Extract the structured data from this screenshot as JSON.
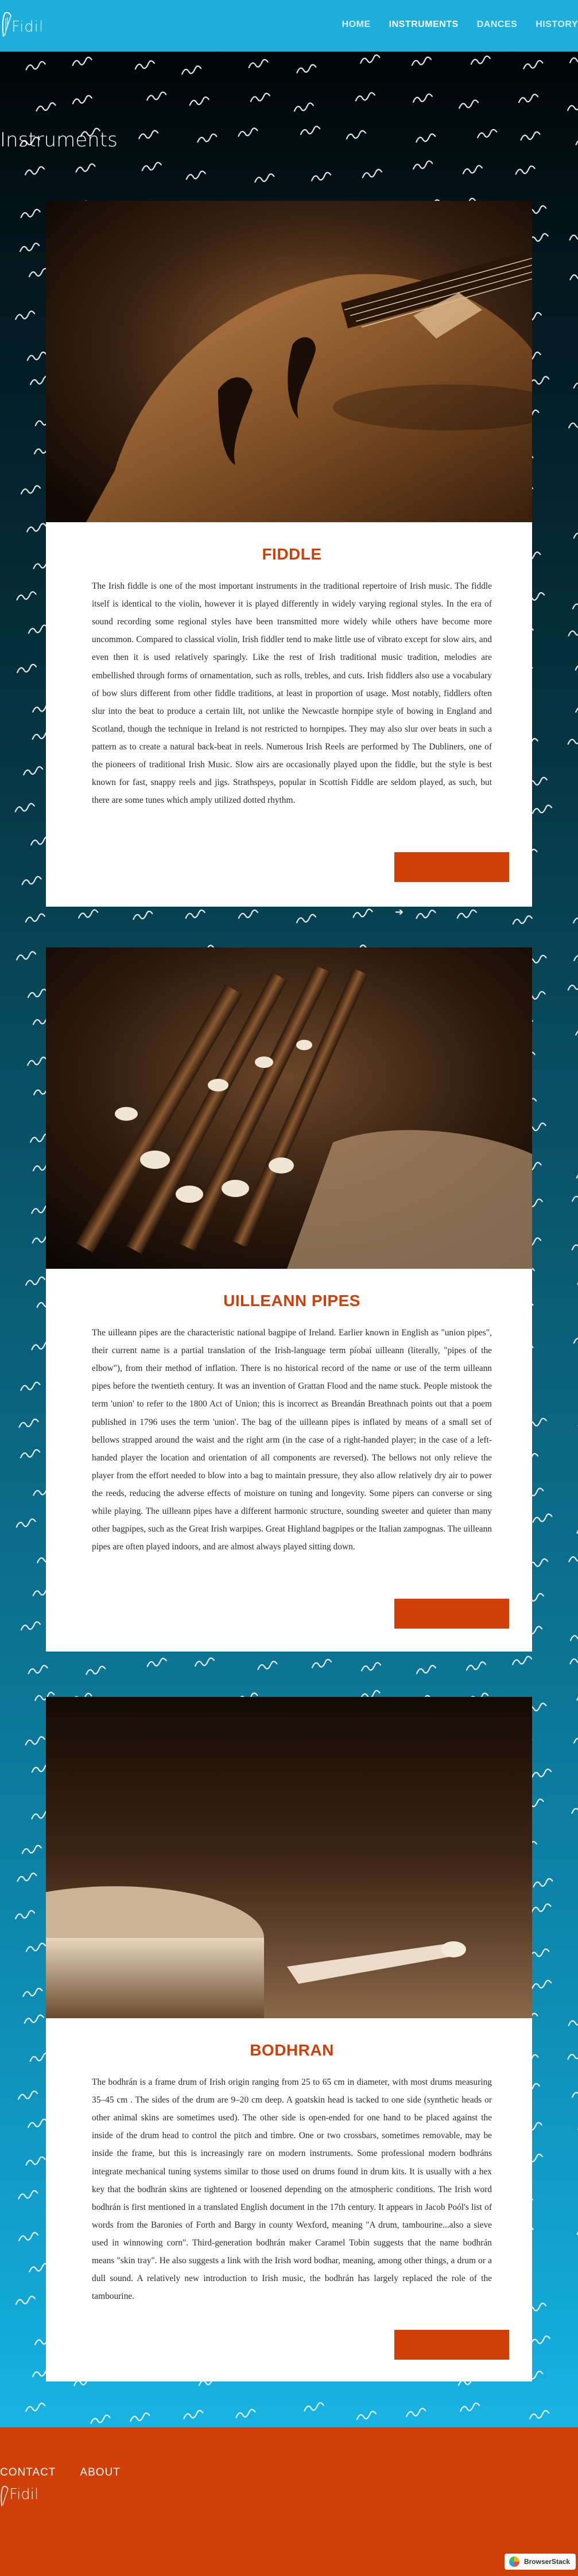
{
  "header": {
    "brand": "Fidil",
    "nav": [
      {
        "label": "HOME"
      },
      {
        "label": "INSTRUMENTS"
      },
      {
        "label": "DANCES"
      },
      {
        "label": "HISTORY"
      }
    ],
    "active_nav": "INSTRUMENTS"
  },
  "page": {
    "title": "Instruments"
  },
  "instruments": [
    {
      "name": "FIDDLE",
      "photo": "violin-photo",
      "text": "The Irish fiddle is one of the most important instruments in the traditional repertoire of Irish music. The fiddle itself is identical to the violin, however it is played differently in widely varying regional styles. In the era of sound recording some regional styles have been transmitted more widely while others have become more uncommon. Compared to classical violin, Irish fiddler tend to make little use of vibrato except for slow airs, and even then it is used relatively sparingly. Like the rest of Irish traditional music tradition, melodies are embellished through forms of ornamentation, such as rolls, trebles, and cuts. Irish fiddlers also use a vocabulary of bow slurs different from other fiddle traditions, at least in proportion of usage. Most notably, fiddlers often slur into the beat to produce a certain lilt, not unlike the Newcastle hornpipe style of bowing in England and Scotland, though the technique in Ireland is not restricted to hornpipes. They may also slur over beats in such a pattern as to create a natural back-beat in reels. Numerous Irish Reels are performed by The Dubliners, one of the pioneers of traditional Irish Music. Slow airs are occasionally played upon the fiddle, but the style is best known for fast, snappy reels and jigs. Strathspeys, popular in Scottish Fiddle are seldom played, as such, but there are some tunes which amply utilized dotted rhythm."
    },
    {
      "name": "UILLEANN PIPES",
      "photo": "pipes-photo",
      "text": "The uilleann pipes are the characteristic national bagpipe of Ireland. Earlier known in English as \"union pipes\", their current name is a partial translation of the Irish-language term píobaí uilleann (literally, \"pipes of the elbow\"), from their method of inflation. There is no historical record of the name or use of the term uilleann pipes before the twentieth century. It was an invention of Grattan Flood and the name stuck. People mistook the term 'union' to refer to the 1800 Act of Union; this is incorrect as Breandán Breathnach points out that a poem published in 1796 uses the term 'union'. The bag of the uilleann pipes is inflated by means of a small set of bellows strapped around the waist and the right arm (in the case of a right-handed player; in the case of a left-handed player the location and orientation of all components are reversed). The bellows not only relieve the player from the effort needed to blow into a bag to maintain pressure, they also allow relatively dry air to power the reeds, reducing the adverse effects of moisture on tuning and longevity. Some pipers can converse or sing while playing. The uilleann pipes have a different harmonic structure, sounding sweeter and quieter than many other bagpipes, such as the Great Irish warpipes. Great Highland bagpipes or the Italian zampognas. The uilleann pipes are often played indoors, and are almost always played sitting down."
    },
    {
      "name": "BODHRAN",
      "photo": "drum-photo",
      "text": "The bodhrán is a frame drum of Irish origin ranging from 25 to 65 cm in diameter, with most drums measuring 35–45 cm . The sides of the drum are 9–20 cm deep. A goatskin head is tacked to one side (synthetic heads or other animal skins are sometimes used). The other side is open-ended for one hand to be placed against the inside of the drum head to control the pitch and timbre. One or two crossbars, sometimes removable, may be inside the frame, but this is increasingly rare on modern instruments. Some professional modern bodhráns integrate mechanical tuning systems similar to those used on drums found in drum kits. It is usually with a hex key that the bodhrán skins are tightened or loosened depending on the atmospheric conditions. The Irish word bodhrán is first mentioned in a translated English document in the 17th century. It appears in Jacob Poól's list of words from the Baronies of Forth and Bargy in county Wexford, meaning \"A drum, tambourine...also a sieve used in winnowing corn\". Third-generation bodhrán maker Caramel Tobin suggests that the name bodhrán means \"skin tray\". He also suggests a link with the Irish word bodhar, meaning, among other things, a drum or a dull sound. A relatively new introduction to Irish music, the bodhrán has largely replaced the role of the tambourine."
    }
  ],
  "footer": {
    "links": [
      {
        "label": "CONTACT"
      },
      {
        "label": "ABOUT"
      }
    ],
    "brand": "Fidil",
    "badge": "BrowserStack"
  },
  "colors": {
    "header": "#1eaedb",
    "accent": "#d13f09",
    "card": "#ffffff"
  }
}
